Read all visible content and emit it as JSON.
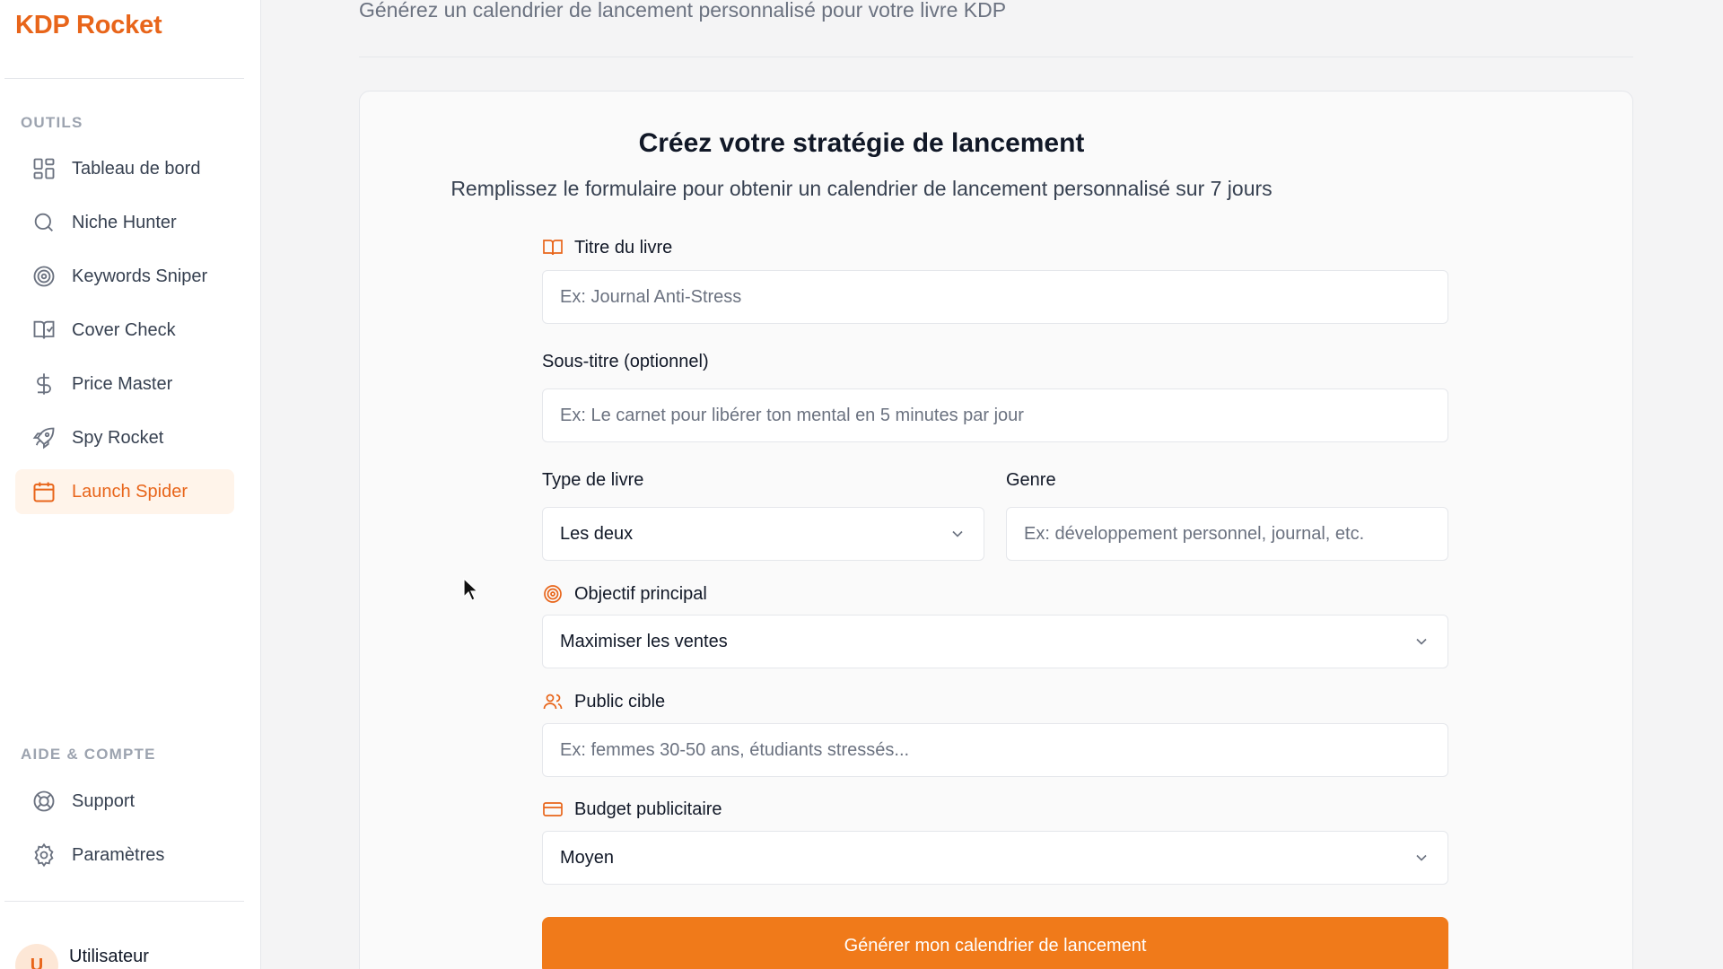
{
  "brand": "KDP Rocket",
  "sidebar": {
    "tools_title": "OUTILS",
    "items": [
      {
        "label": "Tableau de bord",
        "icon": "dashboard-grid-icon"
      },
      {
        "label": "Niche Hunter",
        "icon": "search-icon"
      },
      {
        "label": "Keywords Sniper",
        "icon": "target-icon"
      },
      {
        "label": "Cover Check",
        "icon": "book-check-icon"
      },
      {
        "label": "Price Master",
        "icon": "dollar-icon"
      },
      {
        "label": "Spy Rocket",
        "icon": "rocket-icon"
      },
      {
        "label": "Launch Spider",
        "icon": "calendar-icon",
        "active": true
      }
    ],
    "help_title": "AIDE & COMPTE",
    "help_items": [
      {
        "label": "Support",
        "icon": "lifebuoy-icon"
      },
      {
        "label": "Paramètres",
        "icon": "settings-gear-icon"
      }
    ],
    "user": {
      "name": "Utilisateur",
      "initial": "U"
    }
  },
  "page": {
    "subtitle": "Générez un calendrier de lancement personnalisé pour votre livre KDP"
  },
  "form": {
    "title": "Créez votre stratégie de lancement",
    "subtitle": "Remplissez le formulaire pour obtenir un calendrier de lancement personnalisé sur 7 jours",
    "title_label": "Titre du livre",
    "title_placeholder": "Ex: Journal Anti-Stress",
    "subtitle_label": "Sous-titre (optionnel)",
    "subtitle_placeholder": "Ex: Le carnet pour libérer ton mental en 5 minutes par jour",
    "type_label": "Type de livre",
    "type_value": "Les deux",
    "genre_label": "Genre",
    "genre_placeholder": "Ex: développement personnel, journal, etc.",
    "objective_label": "Objectif principal",
    "objective_value": "Maximiser les ventes",
    "audience_label": "Public cible",
    "audience_placeholder": "Ex: femmes 30-50 ans, étudiants stressés...",
    "budget_label": "Budget publicitaire",
    "budget_value": "Moyen",
    "submit_label": "Générer mon calendrier de lancement"
  },
  "colors": {
    "accent": "#e8651a",
    "button": "#f07a1a",
    "active_bg": "#fff4ea"
  }
}
